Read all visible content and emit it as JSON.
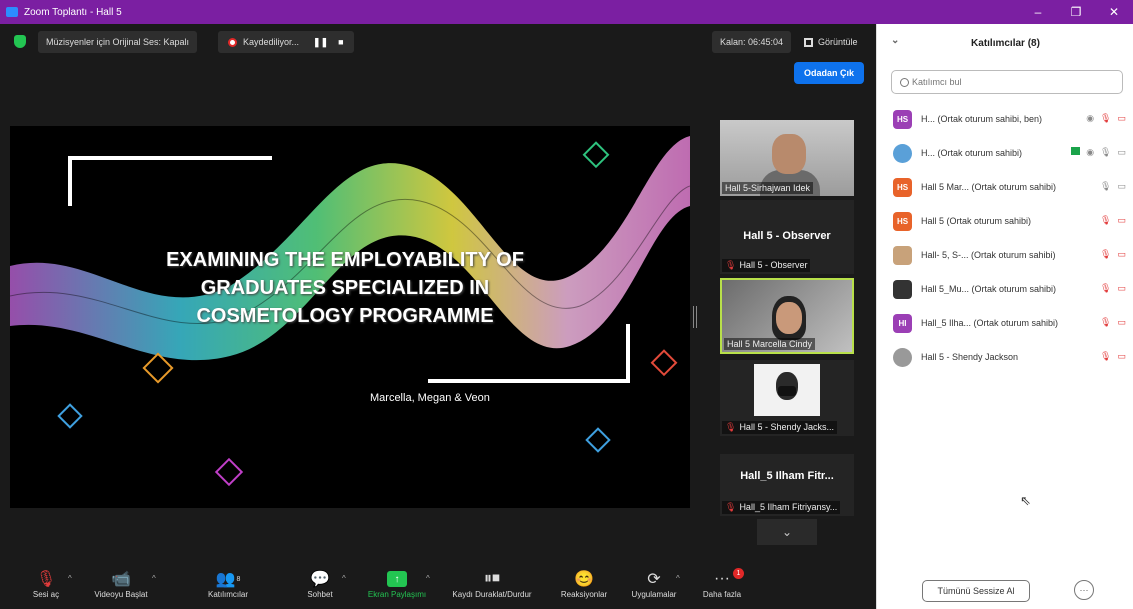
{
  "window": {
    "title": "Zoom Toplantı - Hall 5",
    "minimize": "–",
    "maximize": "❐",
    "close": "✕"
  },
  "topbar": {
    "audio_label": "Müzisyenler için Orijinal Ses: Kapalı",
    "recording_label": "Kaydediliyor...",
    "pause_icon": "❚❚",
    "stop_icon": "■",
    "remaining": "Kalan: 06:45:04",
    "view_label": "Görüntüle"
  },
  "slide": {
    "title_line1": "EXAMINING THE EMPLOYABILITY OF",
    "title_line2": "GRADUATES SPECIALIZED IN",
    "title_line3": "COSMETOLOGY PROGRAMME",
    "authors": "Marcella, Megan & Veon"
  },
  "tiles": [
    {
      "label": "Hall 5-Sirhajwan Idek"
    },
    {
      "bigname": "Hall 5 - Observer",
      "label": "Hall 5 - Observer"
    },
    {
      "label": "Hall 5 Marcella Cindy"
    },
    {
      "label": "Hall 5 - Shendy Jacks..."
    },
    {
      "bigname": "Hall_5 Ilham Fitr...",
      "label": "Hall_5 Ilham Fitriyansy..."
    }
  ],
  "toolbar": {
    "audio": "Sesi aç",
    "video": "Videoyu Başlat",
    "participants": "Katılımcılar",
    "participants_count": "8",
    "chat": "Sohbet",
    "share": "Ekran Paylaşımı",
    "record": "Kaydı Duraklat/Durdur",
    "reactions": "Reaksiyonlar",
    "apps": "Uygulamalar",
    "more": "Daha fazla",
    "more_badge": "1",
    "leave": "Odadan Çık"
  },
  "panel": {
    "title": "Katılımcılar (8)",
    "search_placeholder": "Katılımcı bul",
    "participants": [
      {
        "initials": "HS",
        "color": "#9b3fb5",
        "name": "H... (Ortak oturum sahibi, ben)"
      },
      {
        "initials": "",
        "color": "#5aa0d8",
        "name": "H... (Ortak oturum sahibi)"
      },
      {
        "initials": "HS",
        "color": "#e8632a",
        "name": "Hall 5 Mar... (Ortak oturum sahibi)"
      },
      {
        "initials": "HS",
        "color": "#e8632a",
        "name": "Hall 5 (Ortak oturum sahibi)"
      },
      {
        "initials": "",
        "color": "#c8a27a",
        "name": "Hall- 5, S-... (Ortak oturum sahibi)"
      },
      {
        "initials": "",
        "color": "#333333",
        "name": "Hall 5_Mu... (Ortak oturum sahibi)"
      },
      {
        "initials": "HI",
        "color": "#9b3fb5",
        "name": "Hall_5 Ilha... (Ortak oturum sahibi)"
      },
      {
        "initials": "",
        "color": "#999999",
        "name": "Hall 5 - Shendy Jackson"
      }
    ],
    "mute_all": "Tümünü Sessize Al",
    "more": "···"
  }
}
